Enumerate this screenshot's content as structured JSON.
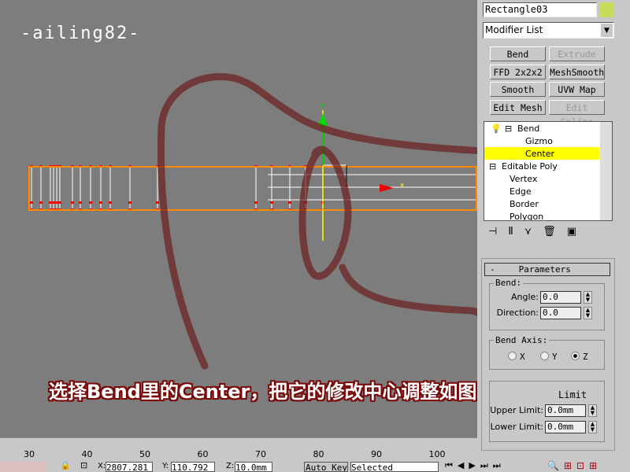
{
  "viewport": {
    "watermark": "-ailing82-",
    "caption": "选择Bend里的Center，把它的修改中心调整如图。"
  },
  "panel": {
    "object_name": "Rectangle03",
    "object_color": "#c4dc5a",
    "modifier_list": "Modifier List",
    "buttons": [
      {
        "label": "Bend",
        "enabled": true
      },
      {
        "label": "Extrude",
        "enabled": false
      },
      {
        "label": "FFD 2x2x2",
        "enabled": true
      },
      {
        "label": "MeshSmooth",
        "enabled": true
      },
      {
        "label": "Smooth",
        "enabled": true
      },
      {
        "label": "UVW Map",
        "enabled": true
      },
      {
        "label": "Edit Mesh",
        "enabled": true
      },
      {
        "label": "Edit Spline",
        "enabled": false
      }
    ],
    "stack": [
      "Bend",
      "Gizmo",
      "Center",
      "Editable Poly",
      "Vertex",
      "Edge",
      "Border",
      "Polygon"
    ],
    "selected_stack_item": "Center",
    "parameters": {
      "title": "Parameters",
      "collapse": "-",
      "bend_group": "Bend:",
      "angle_label": "Angle:",
      "angle": "0.0",
      "direction_label": "Direction:",
      "direction": "0.0",
      "axis_group": "Bend Axis:",
      "axes": [
        "X",
        "Y",
        "Z"
      ],
      "selected_axis": "Z",
      "limit_label": "Limit",
      "upper_label": "Upper Limit:",
      "upper": "0.0mm",
      "lower_label": "Lower Limit:",
      "lower": "0.0mm"
    }
  },
  "timeline": {
    "ticks": [
      "30",
      "40",
      "50",
      "60",
      "70",
      "80",
      "90",
      "100"
    ]
  },
  "status": {
    "x_label": "X:",
    "x": "2807.281",
    "y_label": "Y:",
    "y": "110.792",
    "z_label": "Z:",
    "z": "10.0mm",
    "auto_key": "Auto Key",
    "selected": "Selected"
  }
}
